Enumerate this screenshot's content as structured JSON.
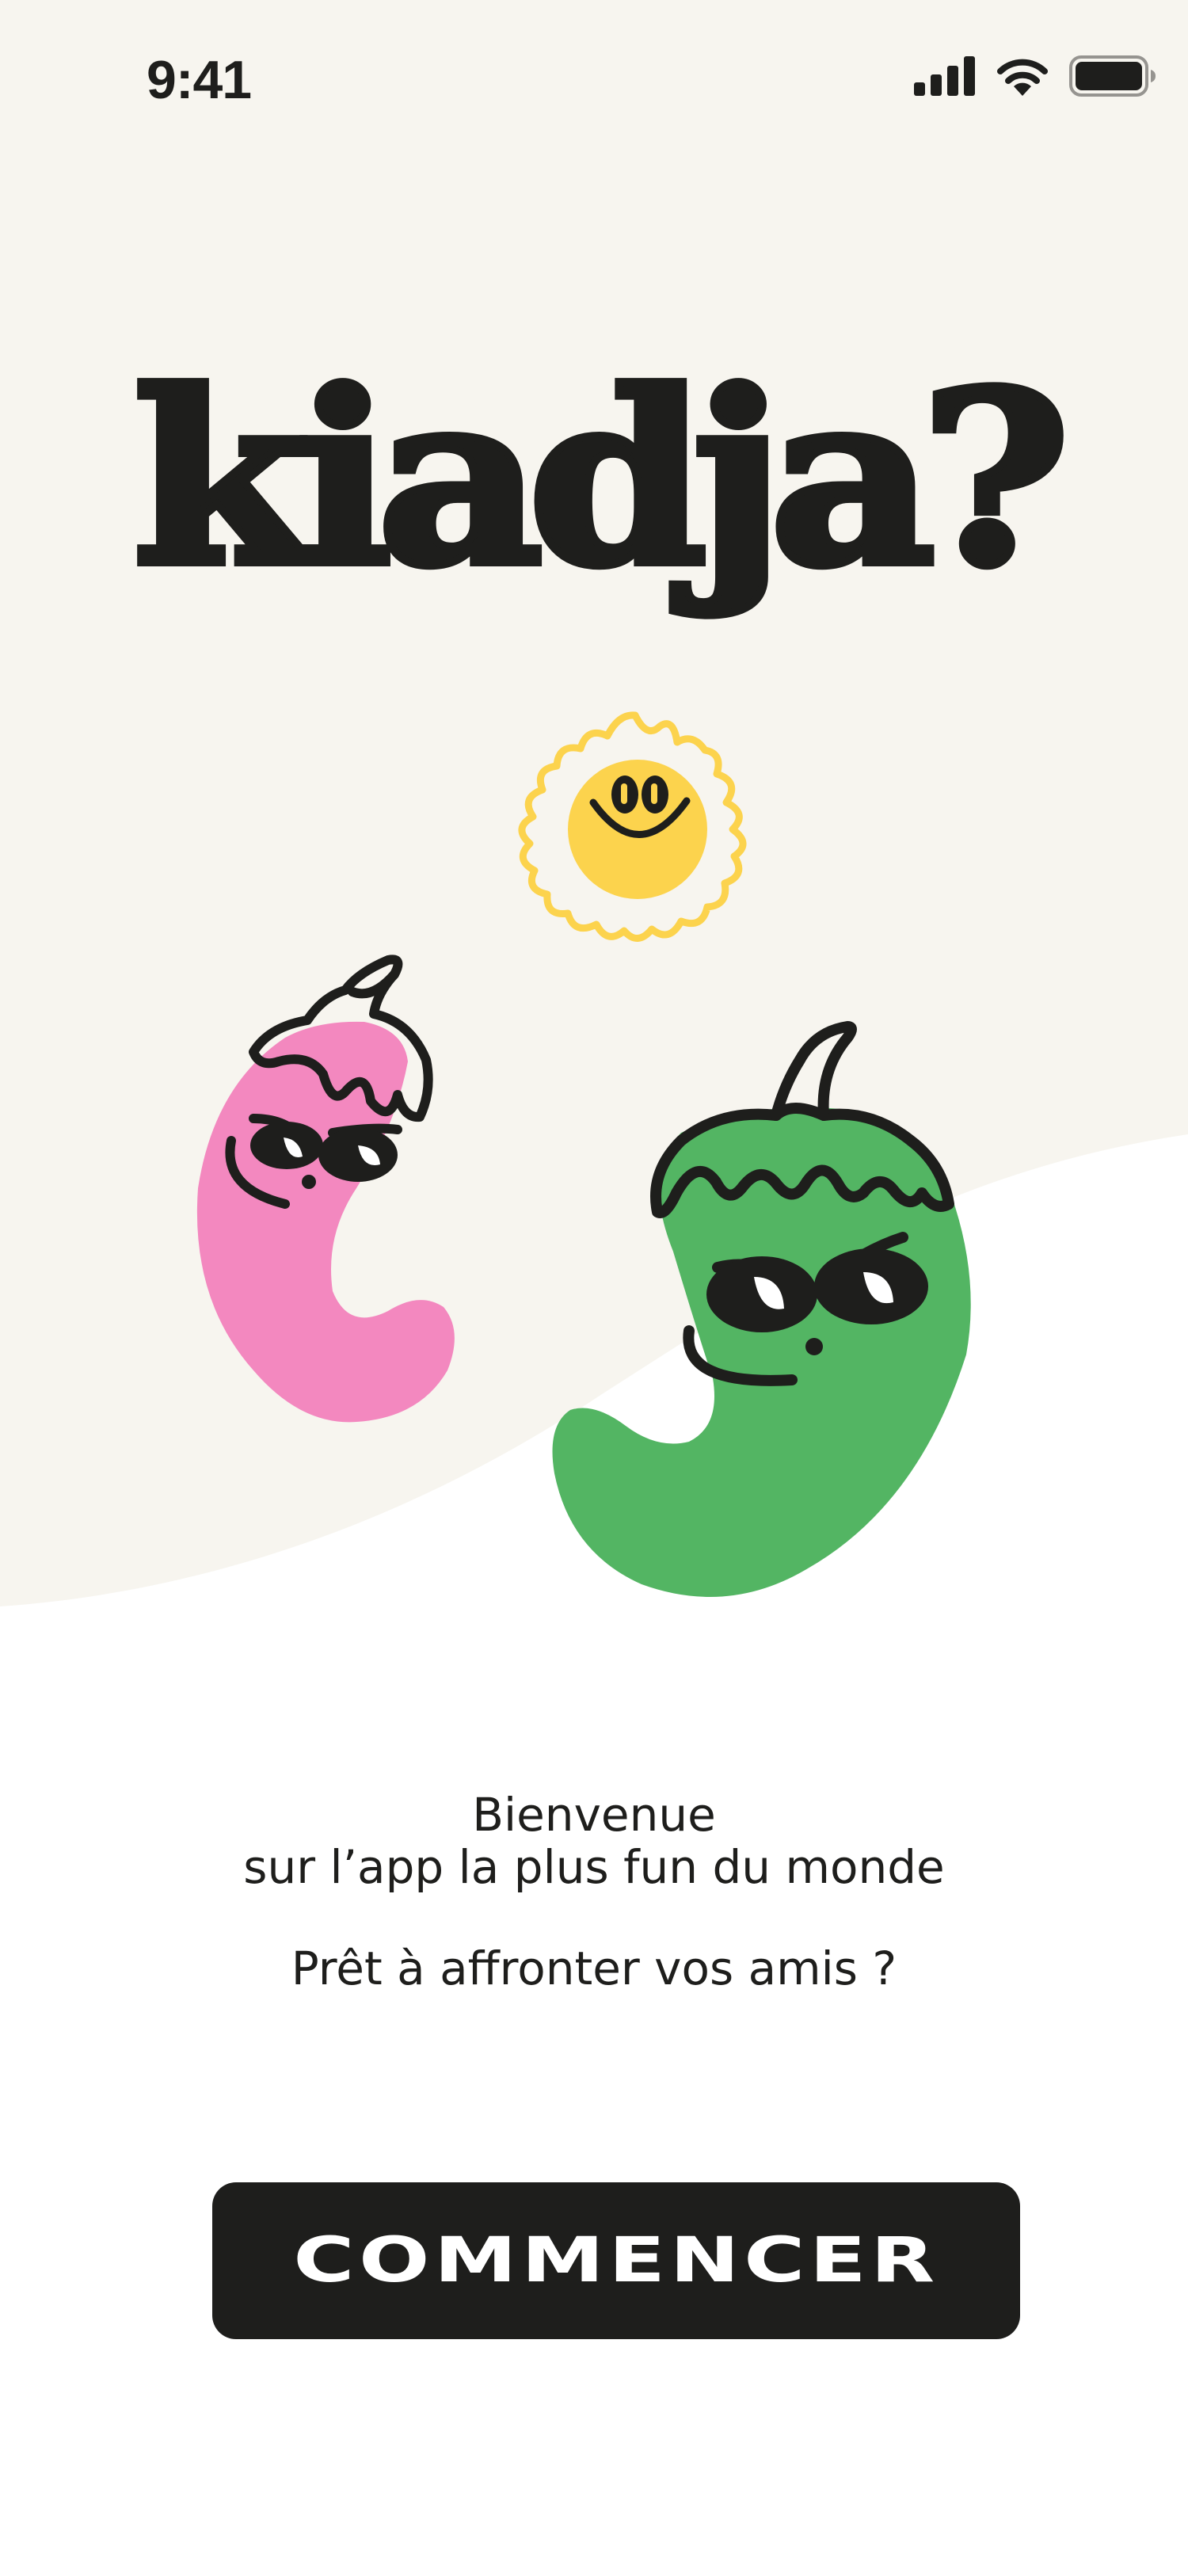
{
  "status_bar": {
    "time": "9:41",
    "icons": [
      "cellular-signal-icon",
      "wifi-icon",
      "battery-icon"
    ]
  },
  "app": {
    "logo_text": "kiadja?"
  },
  "illustrations": [
    "sun-character",
    "pink-pepper-character",
    "green-pepper-character"
  ],
  "welcome": {
    "line1": "Bienvenue",
    "line2": "sur l’app la plus fun du monde",
    "question": "Prêt à affronter vos amis ?"
  },
  "cta": {
    "label": "COMMENCER"
  },
  "colors": {
    "background_top": "#f7f5ef",
    "background_bottom": "#ffffff",
    "ink": "#1e1e1c",
    "sun": "#fcd34d",
    "pink": "#f388bf",
    "green": "#53b563"
  }
}
